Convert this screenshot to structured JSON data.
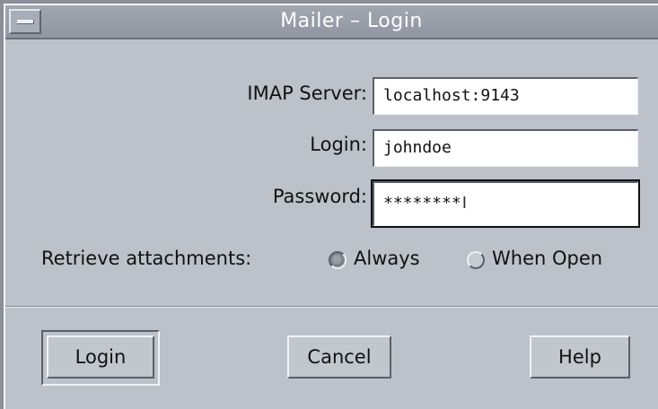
{
  "window": {
    "title": "Mailer – Login"
  },
  "form": {
    "imap_label": "IMAP Server:",
    "imap_value": "localhost:9143",
    "login_label": "Login:",
    "login_value": "johndoe",
    "password_label": "Password:",
    "password_value": "********",
    "attachments_label": "Retrieve attachments:",
    "option_always": "Always",
    "option_when_open": "When Open",
    "selected_option": "Always"
  },
  "buttons": {
    "login": "Login",
    "cancel": "Cancel",
    "help": "Help"
  },
  "icons": {
    "window_menu": "window-menu-icon",
    "text_caret": "text-cursor-icon"
  }
}
